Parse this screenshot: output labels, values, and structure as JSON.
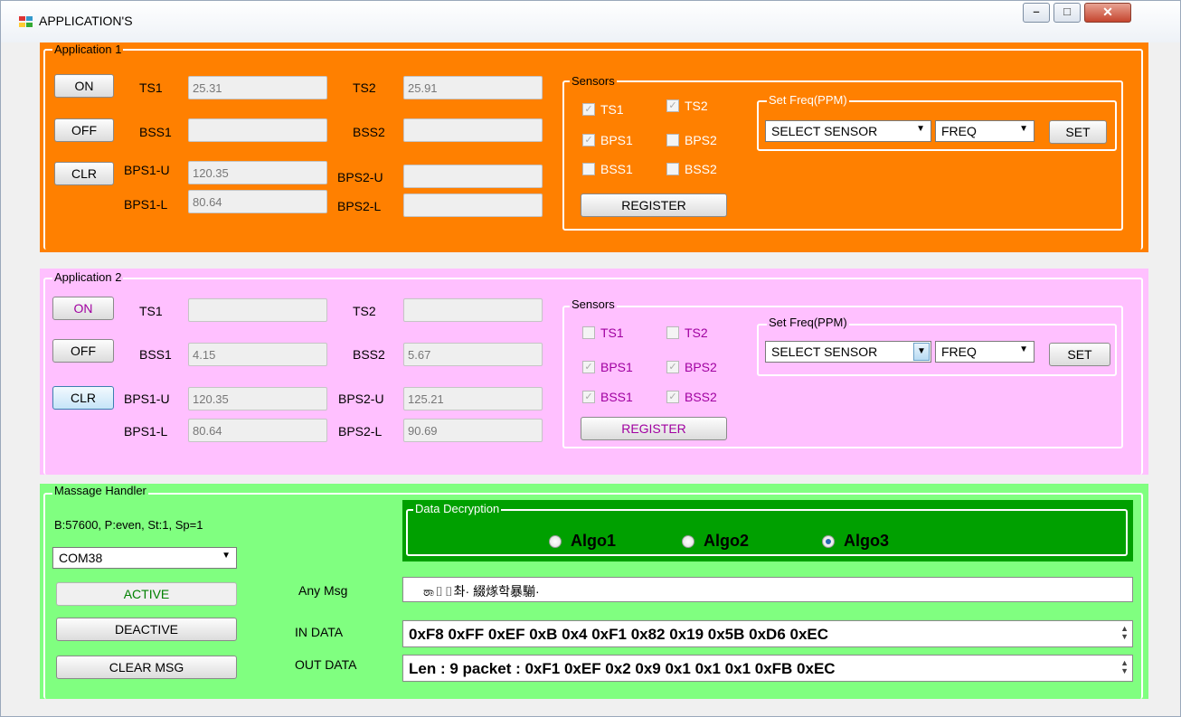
{
  "window": {
    "title": "APPLICATION'S",
    "minimize": "–",
    "maximize": "□",
    "close": "✕"
  },
  "app1": {
    "legend": "Application 1",
    "on": "ON",
    "off": "OFF",
    "clr": "CLR",
    "labels": {
      "ts1": "TS1",
      "ts2": "TS2",
      "bss1": "BSS1",
      "bss2": "BSS2",
      "bps1u": "BPS1-U",
      "bps1l": "BPS1-L",
      "bps2u": "BPS2-U",
      "bps2l": "BPS2-L"
    },
    "values": {
      "ts1": "25.31",
      "ts2": "25.91",
      "bss1": "",
      "bss2": "",
      "bps1u": "120.35",
      "bps1l": "80.64",
      "bps2u": "",
      "bps2l": ""
    },
    "sensors": {
      "legend": "Sensors",
      "ts1": "TS1",
      "ts2": "TS2",
      "bps1": "BPS1",
      "bps2": "BPS2",
      "bss1": "BSS1",
      "bss2": "BSS2",
      "register": "REGISTER",
      "checked": {
        "ts1": true,
        "ts2": true,
        "bps1": true,
        "bps2": false,
        "bss1": false,
        "bss2": false
      }
    },
    "freq": {
      "legend": "Set Freq(PPM)",
      "sensor": "SELECT SENSOR",
      "freq": "FREQ",
      "set": "SET"
    }
  },
  "app2": {
    "legend": "Application 2",
    "on": "ON",
    "off": "OFF",
    "clr": "CLR",
    "labels": {
      "ts1": "TS1",
      "ts2": "TS2",
      "bss1": "BSS1",
      "bss2": "BSS2",
      "bps1u": "BPS1-U",
      "bps1l": "BPS1-L",
      "bps2u": "BPS2-U",
      "bps2l": "BPS2-L"
    },
    "values": {
      "ts1": "",
      "ts2": "",
      "bss1": "4.15",
      "bss2": "5.67",
      "bps1u": "120.35",
      "bps1l": "80.64",
      "bps2u": "125.21",
      "bps2l": "90.69"
    },
    "sensors": {
      "legend": "Sensors",
      "ts1": "TS1",
      "ts2": "TS2",
      "bps1": "BPS1",
      "bps2": "BPS2",
      "bss1": "BSS1",
      "bss2": "BSS2",
      "register": "REGISTER",
      "checked": {
        "ts1": false,
        "ts2": false,
        "bps1": true,
        "bps2": true,
        "bss1": true,
        "bss2": true
      }
    },
    "freq": {
      "legend": "Set Freq(PPM)",
      "sensor": "SELECT SENSOR",
      "freq": "FREQ",
      "set": "SET"
    }
  },
  "msg": {
    "legend": "Massage Handler",
    "config": "B:57600, P:even, St:1, Sp=1",
    "port": "COM38",
    "active": "ACTIVE",
    "deactive": "DEACTIVE",
    "clear": "CLEAR MSG",
    "decrypt": {
      "legend": "Data Decryption",
      "algo1": "Algo1",
      "algo2": "Algo2",
      "algo3": "Algo3",
      "selected": "Algo3"
    },
    "any_label": "Any Msg",
    "any_value": "ಠಾ▯▯촤· 綴煫학暴騚·",
    "in_label": "IN DATA",
    "in_value": "0xF8  0xFF  0xEF  0xB  0x4  0xF1  0x82  0x19  0x5B  0xD6  0xEC",
    "out_label": "OUT DATA",
    "out_value": "Len : 9 packet : 0xF1  0xEF  0x2  0x9  0x1  0x1  0x1  0xFB  0xEC"
  },
  "colors": {
    "app1": "#ff8000",
    "app2": "#ffc0ff",
    "msg": "#80ff80",
    "decrypt": "#00a000",
    "app2_text": "#a000a0",
    "active_text": "#008000"
  }
}
